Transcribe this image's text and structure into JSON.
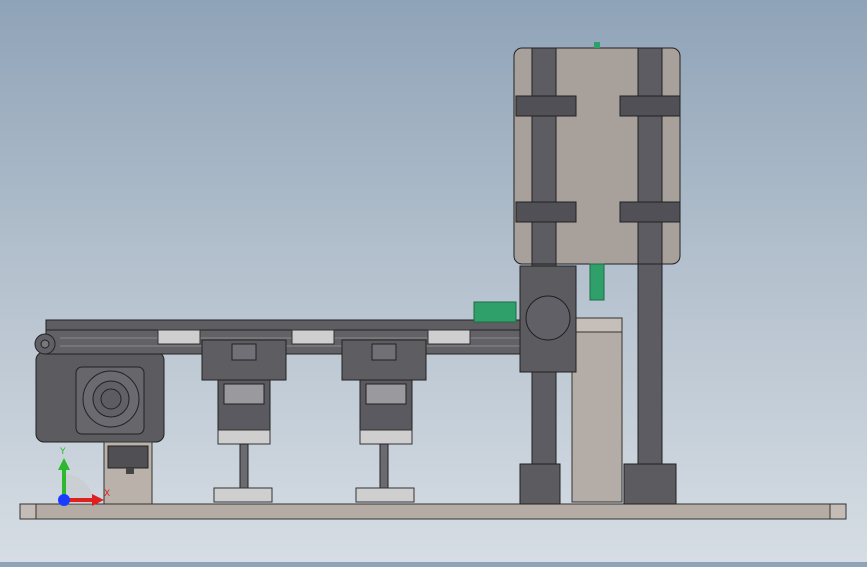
{
  "viewport": {
    "background_top": "#8fa3b8",
    "background_bottom": "#d6dde4"
  },
  "triad": {
    "y_label": "Y",
    "x_label": "X",
    "y_color": "#2eb82e",
    "x_color": "#e02020",
    "z_color": "#1a3cff"
  },
  "model": {
    "part_color": "#a8a09a",
    "dark_part_color": "#5e5e62",
    "steel_color": "#c9c9c9",
    "accent_green": "#2fa06a"
  }
}
